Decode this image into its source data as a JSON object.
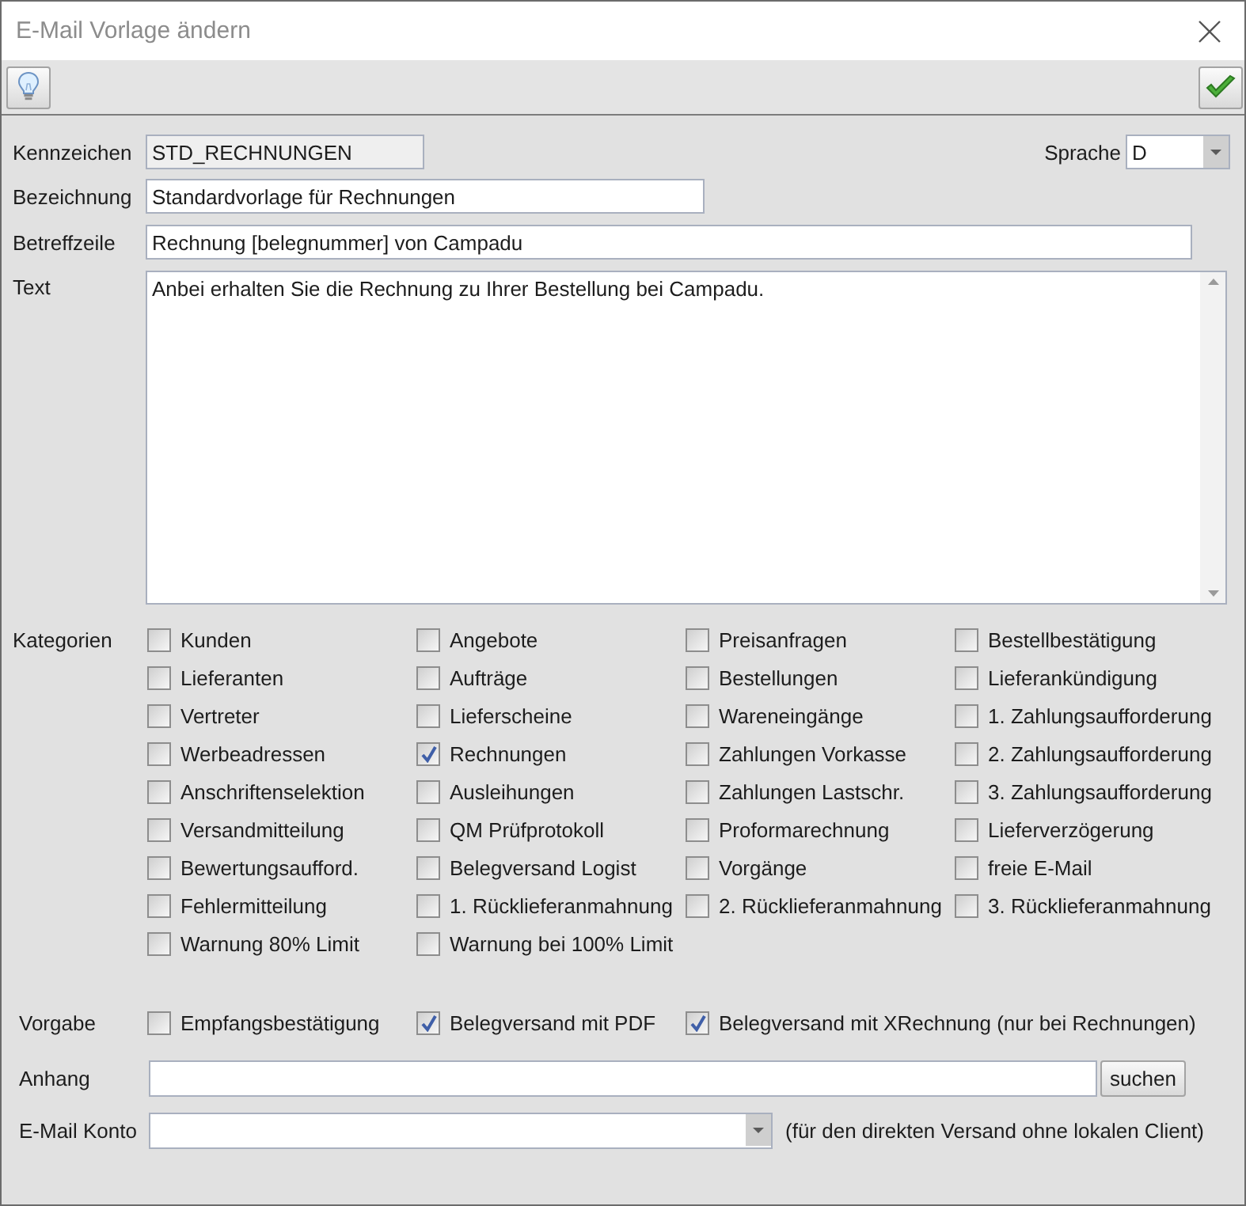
{
  "window": {
    "title": "E-Mail Vorlage ändern"
  },
  "form": {
    "kennzeichen": {
      "label": "Kennzeichen",
      "value": "STD_RECHNUNGEN",
      "readonly": true
    },
    "sprache": {
      "label": "Sprache",
      "value": "D"
    },
    "bezeichnung": {
      "label": "Bezeichnung",
      "value": "Standardvorlage für Rechnungen",
      "readonly": false
    },
    "betreffzeile": {
      "label": "Betreffzeile",
      "value": "Rechnung [belegnummer] von Campadu",
      "readonly": false
    },
    "text": {
      "label": "Text",
      "value": "Anbei erhalten Sie die Rechnung zu Ihrer Bestellung bei Campadu."
    }
  },
  "kategorien": {
    "label": "Kategorien",
    "items": [
      {
        "label": "Kunden",
        "checked": false
      },
      {
        "label": "Angebote",
        "checked": false
      },
      {
        "label": "Preisanfragen",
        "checked": false
      },
      {
        "label": "Bestellbestätigung",
        "checked": false
      },
      {
        "label": "Lieferanten",
        "checked": false
      },
      {
        "label": "Aufträge",
        "checked": false
      },
      {
        "label": "Bestellungen",
        "checked": false
      },
      {
        "label": "Lieferankündigung",
        "checked": false
      },
      {
        "label": "Vertreter",
        "checked": false
      },
      {
        "label": "Lieferscheine",
        "checked": false
      },
      {
        "label": "Wareneingänge",
        "checked": false
      },
      {
        "label": "1. Zahlungsaufforderung",
        "checked": false
      },
      {
        "label": "Werbeadressen",
        "checked": false
      },
      {
        "label": "Rechnungen",
        "checked": true
      },
      {
        "label": "Zahlungen Vorkasse",
        "checked": false
      },
      {
        "label": "2. Zahlungsaufforderung",
        "checked": false
      },
      {
        "label": "Anschriftenselektion",
        "checked": false
      },
      {
        "label": "Ausleihungen",
        "checked": false
      },
      {
        "label": "Zahlungen Lastschr.",
        "checked": false
      },
      {
        "label": "3. Zahlungsaufforderung",
        "checked": false
      },
      {
        "label": "Versandmitteilung",
        "checked": false
      },
      {
        "label": "QM Prüfprotokoll",
        "checked": false
      },
      {
        "label": "Proformarechnung",
        "checked": false
      },
      {
        "label": "Lieferverzögerung",
        "checked": false
      },
      {
        "label": "Bewertungsaufford.",
        "checked": false
      },
      {
        "label": "Belegversand Logist",
        "checked": false
      },
      {
        "label": "Vorgänge",
        "checked": false
      },
      {
        "label": "freie E-Mail",
        "checked": false
      },
      {
        "label": "Fehlermitteilung",
        "checked": false
      },
      {
        "label": "1. Rücklieferanmahnung",
        "checked": false
      },
      {
        "label": "2. Rücklieferanmahnung",
        "checked": false
      },
      {
        "label": "3. Rücklieferanmahnung",
        "checked": false
      },
      {
        "label": "Warnung 80% Limit",
        "checked": false
      },
      {
        "label": "Warnung bei 100% Limit",
        "checked": false
      }
    ]
  },
  "vorgabe": {
    "label": "Vorgabe",
    "options": [
      {
        "label": "Empfangsbestätigung",
        "checked": false
      },
      {
        "label": "Belegversand mit PDF",
        "checked": true
      },
      {
        "label": "Belegversand mit XRechnung (nur bei Rechnungen)",
        "checked": true
      }
    ]
  },
  "anhang": {
    "label": "Anhang",
    "button": "suchen"
  },
  "email_konto": {
    "label": "E-Mail Konto",
    "note": "(für den direkten Versand ohne lokalen Client)"
  }
}
